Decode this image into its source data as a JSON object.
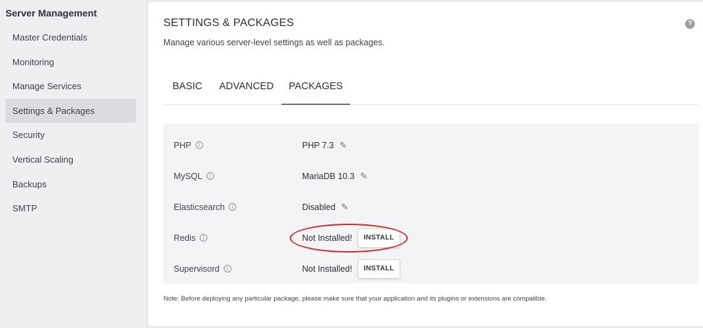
{
  "sidebar": {
    "title": "Server Management",
    "items": [
      {
        "label": "Master Credentials"
      },
      {
        "label": "Monitoring"
      },
      {
        "label": "Manage Services"
      },
      {
        "label": "Settings & Packages"
      },
      {
        "label": "Security"
      },
      {
        "label": "Vertical Scaling"
      },
      {
        "label": "Backups"
      },
      {
        "label": "SMTP"
      }
    ],
    "active_item": "Settings & Packages"
  },
  "header": {
    "title": "SETTINGS & PACKAGES",
    "subtitle": "Manage various server-level settings as well as packages.",
    "help_icon": "question-circle-icon"
  },
  "tabs": [
    {
      "label": "BASIC"
    },
    {
      "label": "ADVANCED"
    },
    {
      "label": "PACKAGES"
    }
  ],
  "active_tab": "PACKAGES",
  "packages": [
    {
      "name": "PHP",
      "value": "PHP 7.3",
      "editable": true
    },
    {
      "name": "MySQL",
      "value": "MariaDB 10.3",
      "editable": true
    },
    {
      "name": "Elasticsearch",
      "value": "Disabled",
      "editable": true
    },
    {
      "name": "Redis",
      "value": "Not Installed!",
      "install_label": "INSTALL"
    },
    {
      "name": "Supervisord",
      "value": "Not Installed!",
      "install_label": "INSTALL"
    }
  ],
  "note": "Note: Before deploying any particular package, please make sure that your application and its plugins or extensions are compatible.",
  "colors": {
    "highlight_ring": "#c9302c",
    "active_sidebar_bg": "#dcdce0",
    "table_bg": "#f4f4f6"
  }
}
